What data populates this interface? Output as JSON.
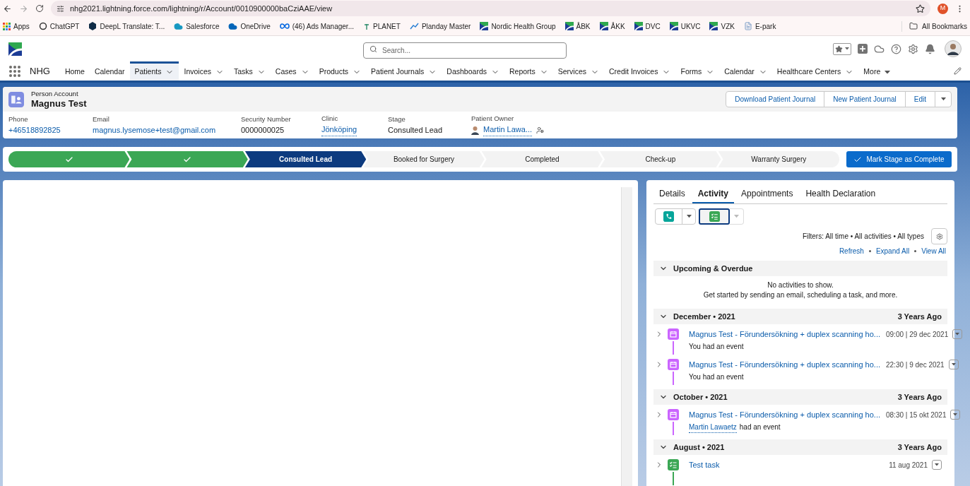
{
  "browser": {
    "url": "nhg2021.lightning.force.com/lightning/r/Account/0010900000baCziAAE/view",
    "profile_letter": "M"
  },
  "bookmarks": [
    {
      "label": "Apps",
      "kind": "apps"
    },
    {
      "label": "ChatGPT",
      "kind": "chatgpt"
    },
    {
      "label": "DeepL Translate: T...",
      "kind": "deepl"
    },
    {
      "label": "Salesforce",
      "kind": "salesforce"
    },
    {
      "label": "OneDrive",
      "kind": "onedrive"
    },
    {
      "label": "(46) Ads Manager...",
      "kind": "meta"
    },
    {
      "label": "PLANET",
      "kind": "planet"
    },
    {
      "label": "Planday Master",
      "kind": "planday"
    },
    {
      "label": "Nordic Health Group",
      "kind": "nhg"
    },
    {
      "label": "ÅBK",
      "kind": "nhg"
    },
    {
      "label": "ÅKK",
      "kind": "nhg"
    },
    {
      "label": "DVC",
      "kind": "nhg"
    },
    {
      "label": "UKVC",
      "kind": "nhg"
    },
    {
      "label": "VZK",
      "kind": "nhg"
    },
    {
      "label": "E-park",
      "kind": "file"
    }
  ],
  "all_bookmarks": "All Bookmarks",
  "header": {
    "search_placeholder": "Search...",
    "app_name": "NHG"
  },
  "nav": [
    {
      "label": "Home",
      "selected": false,
      "kind": "plain"
    },
    {
      "label": "Calendar",
      "selected": false,
      "kind": "plain"
    },
    {
      "label": "Patients",
      "selected": true,
      "kind": "menu"
    },
    {
      "label": "Invoices",
      "selected": false,
      "kind": "menu"
    },
    {
      "label": "Tasks",
      "selected": false,
      "kind": "menu"
    },
    {
      "label": "Cases",
      "selected": false,
      "kind": "menu"
    },
    {
      "label": "Products",
      "selected": false,
      "kind": "menu"
    },
    {
      "label": "Patient Journals",
      "selected": false,
      "kind": "menu"
    },
    {
      "label": "Dashboards",
      "selected": false,
      "kind": "menu"
    },
    {
      "label": "Reports",
      "selected": false,
      "kind": "menu"
    },
    {
      "label": "Services",
      "selected": false,
      "kind": "menu"
    },
    {
      "label": "Credit Invoices",
      "selected": false,
      "kind": "menu"
    },
    {
      "label": "Forms",
      "selected": false,
      "kind": "menu"
    },
    {
      "label": "Calendar",
      "selected": false,
      "kind": "menu"
    },
    {
      "label": "Healthcare Centers",
      "selected": false,
      "kind": "menu"
    },
    {
      "label": "More",
      "selected": false,
      "kind": "more"
    }
  ],
  "record": {
    "type_label": "Person Account",
    "name": "Magnus Test",
    "actions": [
      "Download Patient Journal",
      "New Patient Journal",
      "Edit"
    ],
    "fields": [
      {
        "label": "Phone",
        "value": "+46518892825",
        "kind": "link"
      },
      {
        "label": "Email",
        "value": "magnus.lysemose+test@gmail.com",
        "kind": "link"
      },
      {
        "label": "Security Number",
        "value": "0000000025",
        "kind": "text"
      },
      {
        "label": "Clinic",
        "value": "Jönköping",
        "kind": "record_link"
      },
      {
        "label": "Stage",
        "value": "Consulted Lead",
        "kind": "text"
      },
      {
        "label": "Patient Owner",
        "value": "Martin Lawa...",
        "kind": "owner"
      }
    ]
  },
  "path": {
    "stages": [
      {
        "kind": "complete"
      },
      {
        "kind": "complete"
      },
      {
        "label": "Consulted Lead",
        "kind": "current"
      },
      {
        "label": "Booked for Surgery",
        "kind": "incomplete"
      },
      {
        "label": "Completed",
        "kind": "incomplete"
      },
      {
        "label": "Check-up",
        "kind": "incomplete"
      },
      {
        "label": "Warranty Surgery",
        "kind": "incomplete"
      }
    ],
    "button": "Mark Stage as Complete"
  },
  "tabs": [
    {
      "label": "Details",
      "selected": false
    },
    {
      "label": "Activity",
      "selected": true
    },
    {
      "label": "Appointments",
      "selected": false
    },
    {
      "label": "Health Declaration",
      "selected": false
    }
  ],
  "activity": {
    "filters": "Filters: All time • All activities • All types",
    "links": [
      "Refresh",
      "Expand All",
      "View All"
    ],
    "sections": [
      {
        "title": "Upcoming & Overdue",
        "empty": [
          "No activities to show.",
          "Get started by sending an email, scheduling a task, and more."
        ]
      },
      {
        "title": "December • 2021",
        "ago": "3 Years Ago",
        "items": [
          {
            "kind": "event",
            "title": "Magnus Test - Förundersökning + duplex scanning ho...",
            "time": "09:00 | 29 dec 2021",
            "subtitle": "You had an event"
          },
          {
            "kind": "event",
            "title": "Magnus Test - Förundersökning + duplex scanning ho...",
            "time": "22:30 | 9 dec 2021",
            "subtitle": "You had an event"
          }
        ]
      },
      {
        "title": "October • 2021",
        "ago": "3 Years Ago",
        "items": [
          {
            "kind": "event",
            "title": "Magnus Test - Förundersökning + duplex scanning ho...",
            "time": "08:30 | 15 okt 2021",
            "subtitle_link": "Martin Lawaetz",
            "subtitle": "had an event"
          }
        ]
      },
      {
        "title": "August • 2021",
        "ago": "3 Years Ago",
        "items": [
          {
            "kind": "task",
            "title": "Test task",
            "time": "11 aug 2021"
          }
        ]
      }
    ]
  }
}
